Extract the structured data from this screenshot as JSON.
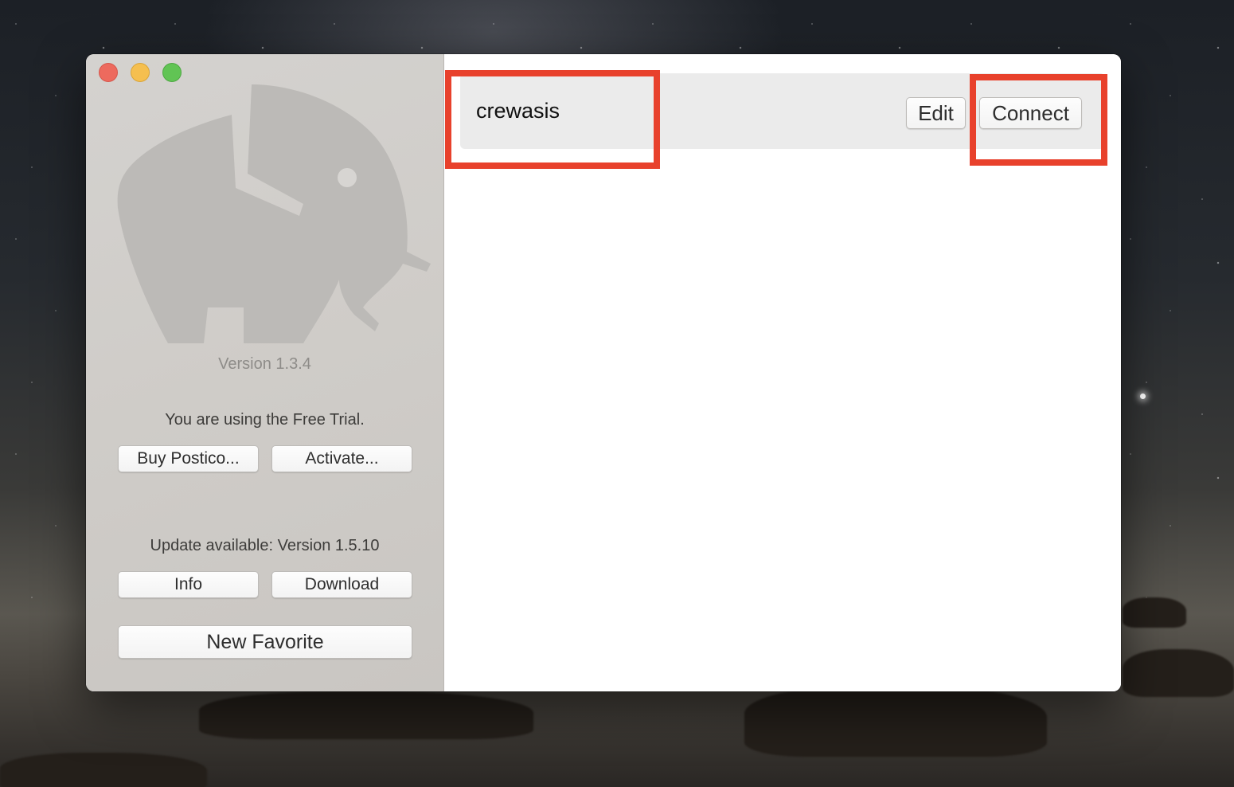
{
  "sidebar": {
    "version": "Version 1.3.4",
    "trial_text": "You are using the Free Trial.",
    "buy_label": "Buy Postico...",
    "activate_label": "Activate...",
    "update_text": "Update available: Version 1.5.10",
    "info_label": "Info",
    "download_label": "Download",
    "new_favorite_label": "New Favorite"
  },
  "main": {
    "favorites": [
      {
        "name": "crewasis",
        "edit_label": "Edit",
        "connect_label": "Connect"
      }
    ]
  },
  "icons": {
    "close": "close-icon",
    "minimize": "minimize-icon",
    "zoom": "zoom-icon",
    "logo": "elephant-logo"
  },
  "colors": {
    "highlight": "#e8412c",
    "traffic_close": "#ed6a5e",
    "traffic_minimize": "#f5bf4f",
    "traffic_zoom": "#61c454"
  }
}
